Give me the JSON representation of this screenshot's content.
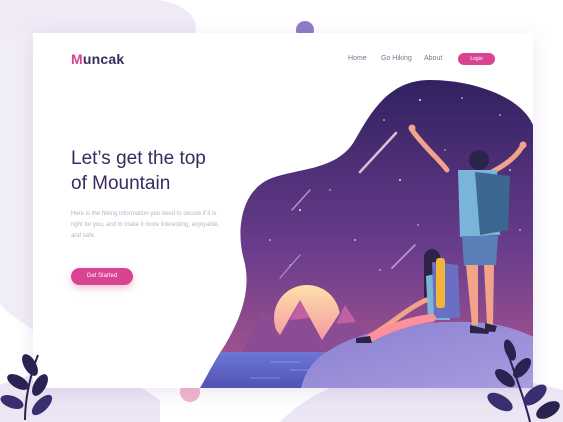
{
  "brand": {
    "logo_initial": "M",
    "logo_rest": "uncak"
  },
  "nav": {
    "home": "Home",
    "go_hiking": "Go Hiking",
    "about": "About",
    "login": "Login"
  },
  "hero": {
    "title_line1": "Let’s get the top",
    "title_line2": "of Mountain",
    "description": "Here is the hiking information you need to decide if it is right for you, and to make it more interesting, enjoyable, and safe.",
    "cta_label": "Get Started"
  },
  "colors": {
    "accent": "#d8448f",
    "heading": "#3a2a5e",
    "night_sky": "#4b2c78",
    "sun": "#f7b58f"
  },
  "icons": [
    "mountain-scene",
    "hikers-illustration",
    "leaf-plant-icon"
  ]
}
